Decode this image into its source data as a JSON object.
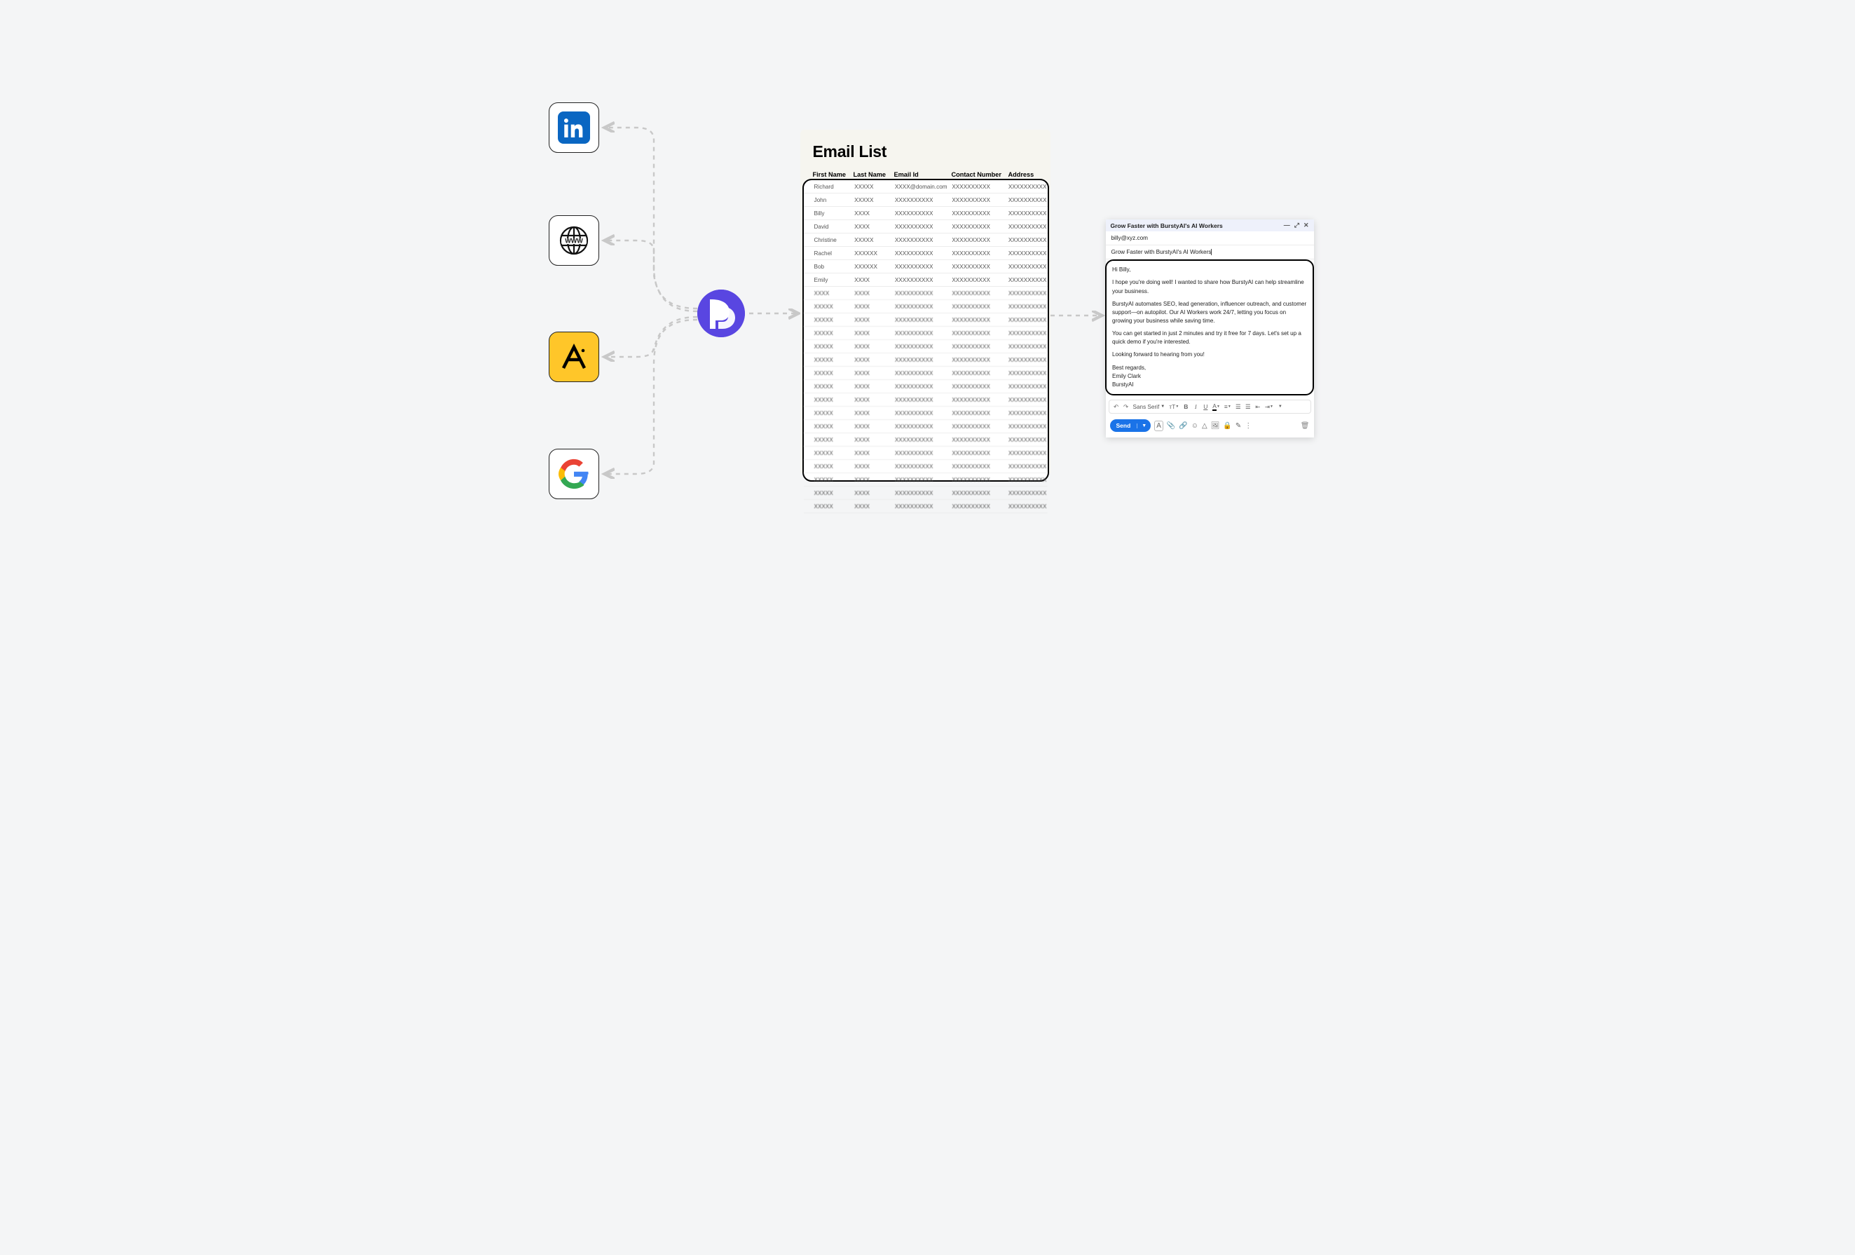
{
  "sources": {
    "linkedin": "LinkedIn",
    "www": "WWW",
    "ai_tool": "AI tool",
    "google": "Google"
  },
  "hub": "BurstyAI",
  "emailList": {
    "title": "Email List",
    "headers": {
      "firstName": "First Name",
      "lastName": "Last Name",
      "emailId": "Email Id",
      "contactNumber": "Contact Number",
      "address": "Address"
    },
    "rows": [
      {
        "fn": "Richard",
        "ln": "XXXXX",
        "ei": "XXXX@domain.com",
        "cn": "XXXXXXXXXX",
        "ad": "XXXXXXXXXX"
      },
      {
        "fn": "John",
        "ln": "XXXXX",
        "ei": "XXXXXXXXXX",
        "cn": "XXXXXXXXXX",
        "ad": "XXXXXXXXXX"
      },
      {
        "fn": "Billy",
        "ln": "XXXX",
        "ei": "XXXXXXXXXX",
        "cn": "XXXXXXXXXX",
        "ad": "XXXXXXXXXX"
      },
      {
        "fn": "David",
        "ln": "XXXX",
        "ei": "XXXXXXXXXX",
        "cn": "XXXXXXXXXX",
        "ad": "XXXXXXXXXX"
      },
      {
        "fn": "Christine",
        "ln": "XXXXX",
        "ei": "XXXXXXXXXX",
        "cn": "XXXXXXXXXX",
        "ad": "XXXXXXXXXX"
      },
      {
        "fn": "Rachel",
        "ln": "XXXXXX",
        "ei": "XXXXXXXXXX",
        "cn": "XXXXXXXXXX",
        "ad": "XXXXXXXXXX"
      },
      {
        "fn": "Bob",
        "ln": "XXXXXX",
        "ei": "XXXXXXXXXX",
        "cn": "XXXXXXXXXX",
        "ad": "XXXXXXXXXX"
      },
      {
        "fn": "Emily",
        "ln": "XXXX",
        "ei": "XXXXXXXXXX",
        "cn": "XXXXXXXXXX",
        "ad": "XXXXXXXXXX"
      },
      {
        "fn": "XXXX",
        "ln": "XXXX",
        "ei": "XXXXXXXXXX",
        "cn": "XXXXXXXXXX",
        "ad": "XXXXXXXXXX"
      },
      {
        "fn": "XXXXX",
        "ln": "XXXX",
        "ei": "XXXXXXXXXX",
        "cn": "XXXXXXXXXX",
        "ad": "XXXXXXXXXX"
      },
      {
        "fn": "XXXXX",
        "ln": "XXXX",
        "ei": "XXXXXXXXXX",
        "cn": "XXXXXXXXXX",
        "ad": "XXXXXXXXXX"
      },
      {
        "fn": "XXXXX",
        "ln": "XXXX",
        "ei": "XXXXXXXXXX",
        "cn": "XXXXXXXXXX",
        "ad": "XXXXXXXXXX"
      },
      {
        "fn": "XXXXX",
        "ln": "XXXX",
        "ei": "XXXXXXXXXX",
        "cn": "XXXXXXXXXX",
        "ad": "XXXXXXXXXX"
      },
      {
        "fn": "XXXXX",
        "ln": "XXXX",
        "ei": "XXXXXXXXXX",
        "cn": "XXXXXXXXXX",
        "ad": "XXXXXXXXXX"
      },
      {
        "fn": "XXXXX",
        "ln": "XXXX",
        "ei": "XXXXXXXXXX",
        "cn": "XXXXXXXXXX",
        "ad": "XXXXXXXXXX"
      },
      {
        "fn": "XXXXX",
        "ln": "XXXX",
        "ei": "XXXXXXXXXX",
        "cn": "XXXXXXXXXX",
        "ad": "XXXXXXXXXX"
      },
      {
        "fn": "XXXXX",
        "ln": "XXXX",
        "ei": "XXXXXXXXXX",
        "cn": "XXXXXXXXXX",
        "ad": "XXXXXXXXXX"
      },
      {
        "fn": "XXXXX",
        "ln": "XXXX",
        "ei": "XXXXXXXXXX",
        "cn": "XXXXXXXXXX",
        "ad": "XXXXXXXXXX"
      },
      {
        "fn": "XXXXX",
        "ln": "XXXX",
        "ei": "XXXXXXXXXX",
        "cn": "XXXXXXXXXX",
        "ad": "XXXXXXXXXX"
      },
      {
        "fn": "XXXXX",
        "ln": "XXXX",
        "ei": "XXXXXXXXXX",
        "cn": "XXXXXXXXXX",
        "ad": "XXXXXXXXXX"
      },
      {
        "fn": "XXXXX",
        "ln": "XXXX",
        "ei": "XXXXXXXXXX",
        "cn": "XXXXXXXXXX",
        "ad": "XXXXXXXXXX"
      },
      {
        "fn": "XXXXX",
        "ln": "XXXX",
        "ei": "XXXXXXXXXX",
        "cn": "XXXXXXXXXX",
        "ad": "XXXXXXXXXX"
      },
      {
        "fn": "XXXXX",
        "ln": "XXXX",
        "ei": "XXXXXXXXXX",
        "cn": "XXXXXXXXXX",
        "ad": "XXXXXXXXXX"
      },
      {
        "fn": "XXXXX",
        "ln": "XXXX",
        "ei": "XXXXXXXXXX",
        "cn": "XXXXXXXXXX",
        "ad": "XXXXXXXXXX"
      },
      {
        "fn": "XXXXX",
        "ln": "XXXX",
        "ei": "XXXXXXXXXX",
        "cn": "XXXXXXXXXX",
        "ad": "XXXXXXXXXX"
      }
    ]
  },
  "compose": {
    "windowTitle": "Grow Faster with BurstyAI's AI Workers",
    "to": "billy@xyz.com",
    "subject": "Grow Faster with BurstyAI's AI Workers",
    "greeting": "Hi Billy,",
    "p1": "I hope you're doing well! I wanted to share how BurstyAI can help streamline your business.",
    "p2": "BurstyAI automates SEO, lead generation, influencer outreach, and customer support—on autopilot. Our AI Workers work 24/7, letting you focus on growing your business while saving time.",
    "p3": "You can get started in just 2 minutes and try it free for 7 days. Let's set up a quick demo if you're interested.",
    "p4": "Looking forward to hearing from you!",
    "signoff": "Best regards,",
    "name": "Emily Clark",
    "company": "BurstyAI",
    "fontName": "Sans Serif",
    "sendLabel": "Send"
  }
}
